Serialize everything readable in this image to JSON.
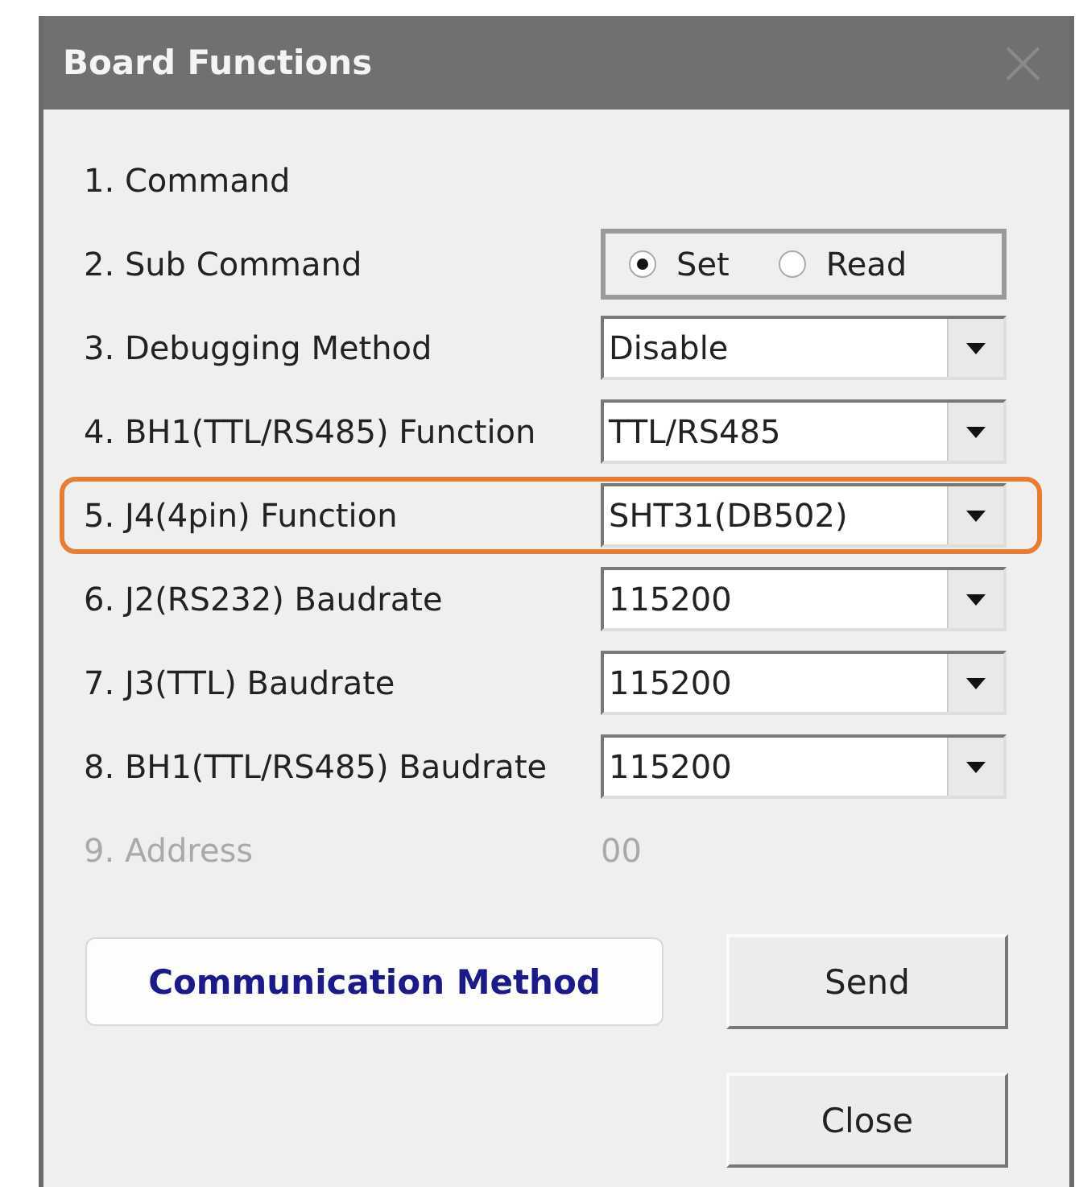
{
  "window": {
    "title": "Board Functions",
    "close": "×"
  },
  "rows": [
    {
      "kind": "label",
      "label": "1. Command",
      "highlighted": false,
      "disabled": false
    },
    {
      "kind": "radio",
      "label": "2. Sub Command",
      "highlighted": false,
      "disabled": false,
      "options": [
        {
          "label": "Set",
          "selected": true
        },
        {
          "label": "Read",
          "selected": false
        }
      ]
    },
    {
      "kind": "combo",
      "label": "3. Debugging Method",
      "value": "Disable",
      "highlighted": false,
      "disabled": false
    },
    {
      "kind": "combo",
      "label": "4. BH1(TTL/RS485) Function",
      "value": "TTL/RS485",
      "highlighted": false,
      "disabled": false
    },
    {
      "kind": "combo",
      "label": "5. J4(4pin) Function",
      "value": "SHT31(DB502)",
      "highlighted": true,
      "disabled": false
    },
    {
      "kind": "combo",
      "label": "6. J2(RS232) Baudrate",
      "value": "115200",
      "highlighted": false,
      "disabled": false
    },
    {
      "kind": "combo",
      "label": "7. J3(TTL) Baudrate",
      "value": "115200",
      "highlighted": false,
      "disabled": false
    },
    {
      "kind": "combo",
      "label": "8. BH1(TTL/RS485) Baudrate",
      "value": "115200",
      "highlighted": false,
      "disabled": false
    },
    {
      "kind": "text",
      "label": "9. Address",
      "value": "00",
      "highlighted": false,
      "disabled": true
    }
  ],
  "buttons": {
    "communication": "Communication Method",
    "send": "Send",
    "close": "Close"
  }
}
